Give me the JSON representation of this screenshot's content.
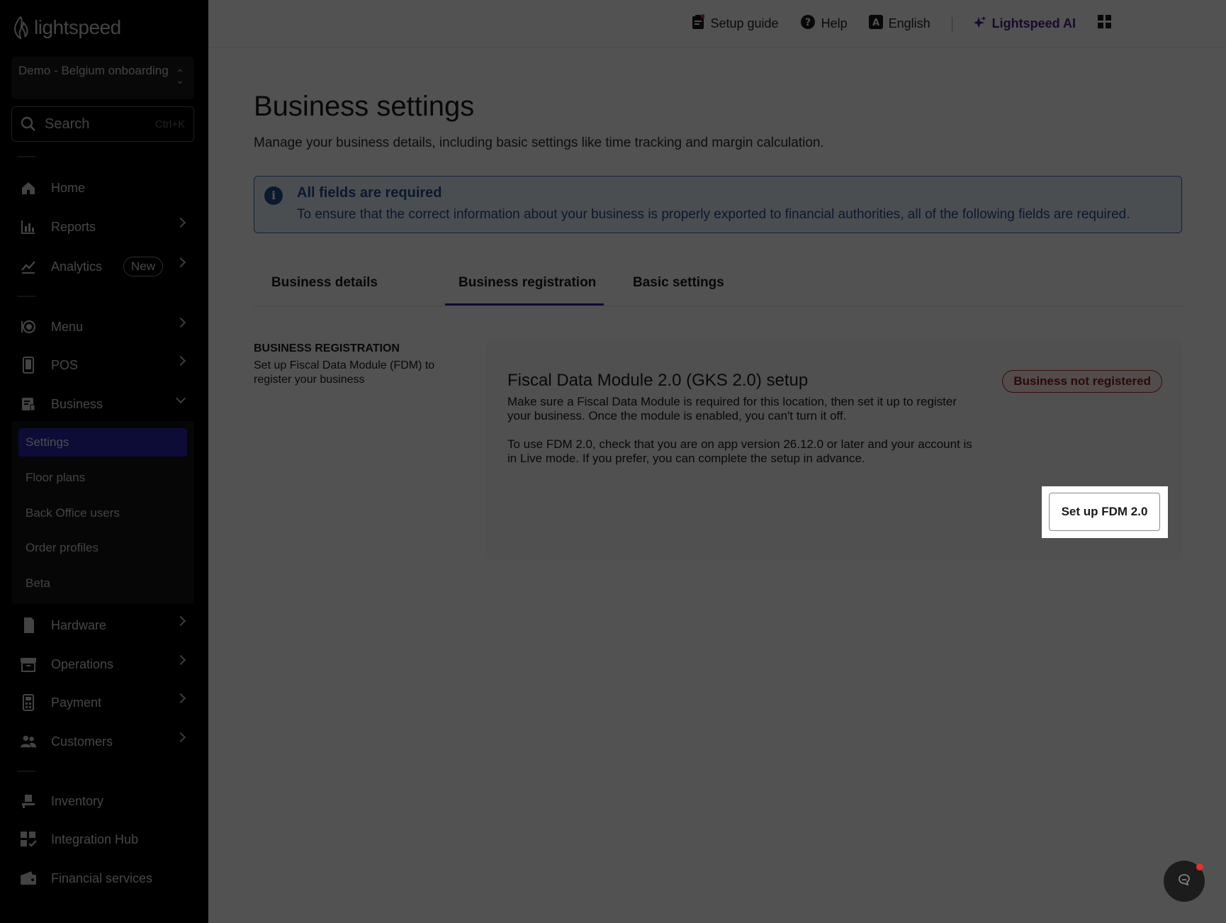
{
  "brand": {
    "name": "lightspeed"
  },
  "sidebar": {
    "location": "Demo - Belgium onboarding",
    "search": {
      "label": "Search",
      "shortcut": "Ctrl+K"
    },
    "items": {
      "home": "Home",
      "reports": "Reports",
      "analytics": "Analytics",
      "analytics_badge": "New",
      "menu": "Menu",
      "pos": "POS",
      "business": "Business",
      "hardware": "Hardware",
      "operations": "Operations",
      "payment": "Payment",
      "customers": "Customers",
      "inventory": "Inventory",
      "integration_hub": "Integration Hub",
      "financial_services": "Financial services"
    },
    "business_submenu": [
      "Settings",
      "Floor plans",
      "Back Office users",
      "Order profiles",
      "Beta"
    ]
  },
  "topbar": {
    "setup_guide": "Setup guide",
    "help": "Help",
    "language": "English",
    "ai": "Lightspeed AI"
  },
  "page": {
    "title": "Business settings",
    "subtitle": "Manage your business details, including basic settings like time tracking and margin calculation."
  },
  "notice": {
    "title": "All fields are required",
    "body": "To ensure that the correct information about your business is properly exported to financial authorities, all of the following fields are required."
  },
  "tabs": [
    "Business details",
    "Business registration",
    "Basic settings"
  ],
  "active_tab": "Business registration",
  "section": {
    "heading": "BUSINESS REGISTRATION",
    "description": "Set up Fiscal Data Module (FDM) to register your business"
  },
  "card": {
    "title": "Fiscal Data Module 2.0 (GKS 2.0) setup",
    "status": "Business not registered",
    "para1": "Make sure a Fiscal Data Module is required for this location, then set it up to register your business. Once the module is enabled, you can't turn it off.",
    "para2": "To use FDM 2.0, check that you are on app version 26.12.0 or later and your account is in Live mode. If you prefer, you can complete the setup in advance.",
    "button": "Set up FDM 2.0"
  },
  "colors": {
    "accent": "#2b27a8",
    "info": "#1f4f8f",
    "danger": "#b3261e",
    "ai": "#4a1e8a"
  }
}
